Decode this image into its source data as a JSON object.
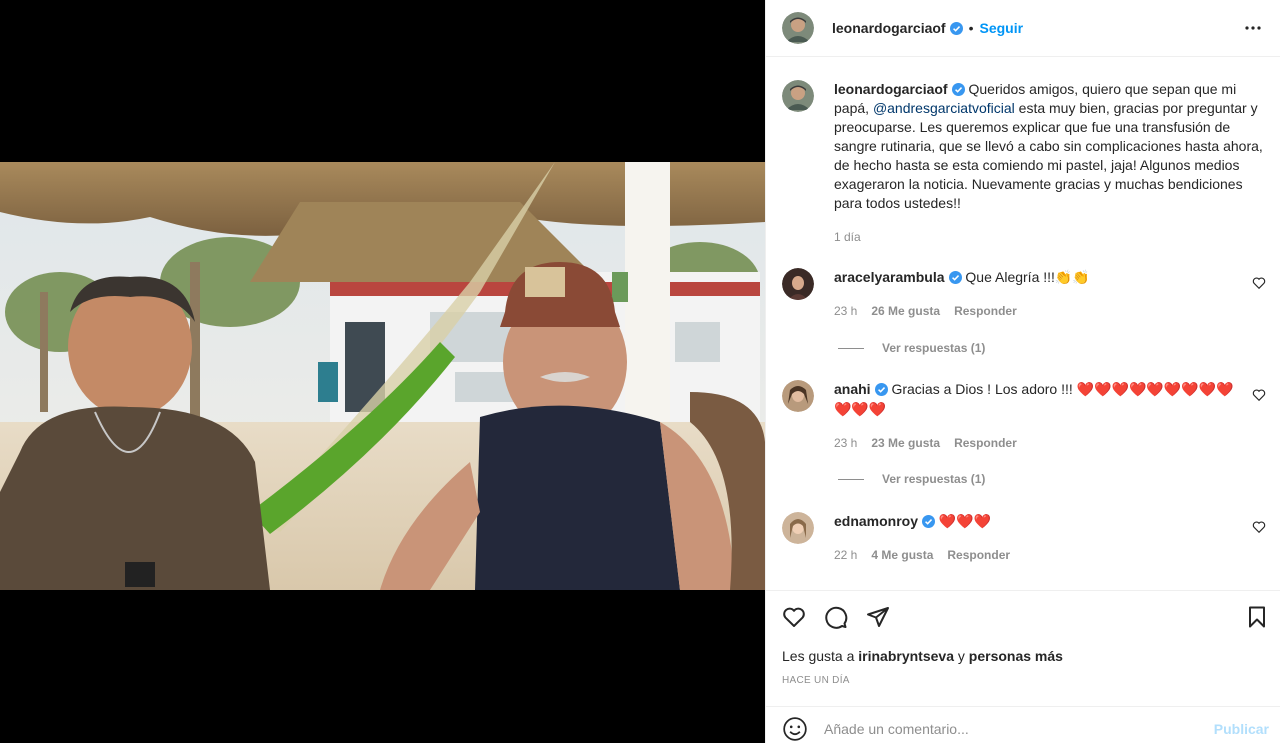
{
  "post": {
    "author": "leonardogarciaof",
    "follow_label": "Seguir",
    "caption_text": " Queridos amigos, quiero que sepan que mi papá, ",
    "caption_mention": "@andresgarciatvoficial",
    "caption_rest": " esta muy bien, gracias por preguntar y preocuparse. Les queremos explicar que fue una transfusión de sangre rutinaria, que se llevó a cabo sin complicaciones hasta ahora, de hecho hasta se esta comiendo mi pastel, jaja! Algunos medios exageraron la noticia. Nuevamente gracias y muchas bendiciones para todos ustedes!!",
    "caption_time": "1 día"
  },
  "comments": [
    {
      "user": "aracelyarambula",
      "text": " Que Alegría !!!",
      "emoji": "👏👏",
      "time": "23 h",
      "likes": "26 Me gusta",
      "reply": "Responder",
      "view_replies": "Ver respuestas (1)"
    },
    {
      "user": "anahi",
      "text": " Gracias a Dios ! Los adoro !!! ",
      "emoji": "❤️❤️❤️❤️❤️❤️❤️❤️❤️❤️❤️❤️",
      "time": "23 h",
      "likes": "23 Me gusta",
      "reply": "Responder",
      "view_replies": "Ver respuestas (1)"
    },
    {
      "user": "ednamonroy",
      "text": " ",
      "emoji": "❤️❤️❤️",
      "time": "22 h",
      "likes": "4 Me gusta",
      "reply": "Responder"
    }
  ],
  "footer": {
    "likes_prefix": "Les gusta a ",
    "likes_user": "irinabryntseva",
    "likes_mid": " y ",
    "likes_more": "personas más",
    "time_ago": "HACE UN DÍA",
    "comment_placeholder": "Añade un comentario...",
    "publish_label": "Publicar"
  },
  "colors": {
    "accent": "#0095f6",
    "verified": "#3897f0",
    "heart": "#ed4956"
  }
}
